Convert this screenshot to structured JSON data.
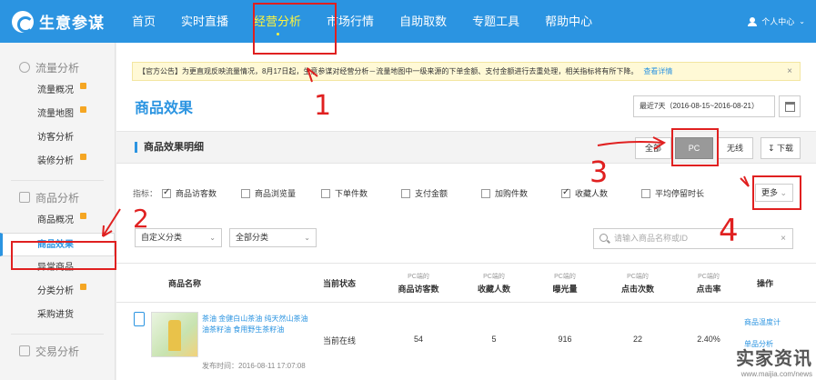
{
  "app": {
    "name": "生意参谋"
  },
  "nav": {
    "items": [
      "首页",
      "实时直播",
      "经营分析",
      "市场行情",
      "自助取数",
      "专题工具",
      "帮助中心"
    ],
    "active_index": 2
  },
  "user": {
    "label": "个人中心"
  },
  "sidebar": {
    "groups": [
      {
        "title": "流量分析",
        "items": [
          "流量概况",
          "流量地图",
          "访客分析",
          "装修分析"
        ]
      },
      {
        "title": "商品分析",
        "items": [
          "商品概况",
          "商品效果",
          "异常商品",
          "分类分析",
          "采购进货"
        ]
      },
      {
        "title": "交易分析"
      }
    ],
    "active_item": "商品效果"
  },
  "notice": {
    "text": "【官方公告】为更直观反映流量情况，8月17日起，生意参谋对经营分析－流量地图中一级来源的下单金额、支付金额进行去重处理，相关指标将有所下降。",
    "link": "查看详情",
    "close": "×"
  },
  "page": {
    "title": "商品效果"
  },
  "date_range": "最近7天（2016-08-15~2016-08-21）",
  "section": {
    "title": "商品效果明细",
    "segments": [
      "全部",
      "PC",
      "无线"
    ],
    "active_segment": "PC",
    "download": "下载"
  },
  "metrics": {
    "label": "指标：",
    "items": [
      {
        "label": "商品访客数",
        "checked": true
      },
      {
        "label": "商品浏览量",
        "checked": false
      },
      {
        "label": "下单件数",
        "checked": false
      },
      {
        "label": "支付金额",
        "checked": false
      },
      {
        "label": "加购件数",
        "checked": false
      },
      {
        "label": "收藏人数",
        "checked": true
      },
      {
        "label": "平均停留时长",
        "checked": false
      }
    ],
    "more": "更多"
  },
  "filters": {
    "custom_category": "自定义分类",
    "all_category": "全部分类",
    "search_placeholder": "请输入商品名称或ID"
  },
  "table": {
    "headers": [
      {
        "top": "",
        "main": "商品名称"
      },
      {
        "top": "",
        "main": "当前状态"
      },
      {
        "top": "PC端的",
        "main": "商品访客数"
      },
      {
        "top": "PC端的",
        "main": "收藏人数"
      },
      {
        "top": "PC端的",
        "main": "曝光量"
      },
      {
        "top": "PC端的",
        "main": "点击次数"
      },
      {
        "top": "PC端的",
        "main": "点击率"
      },
      {
        "top": "",
        "main": "操作"
      }
    ],
    "rows": [
      {
        "name": "茶油 金健白山茶油 纯天然山茶油 油茶籽油 食用野生茶籽油",
        "published": "发布时间：2016-08-11 17:07:08",
        "status": "当前在线",
        "visitors": "54",
        "favorites": "5",
        "exposure": "916",
        "clicks": "22",
        "ctr": "2.40%",
        "op1": "商品温度计",
        "op2": "单品分析"
      }
    ]
  },
  "annotations": [
    "1",
    "2",
    "3",
    "4"
  ],
  "watermark": {
    "brand": "实家资讯",
    "url": "www.maijia.com/news"
  }
}
